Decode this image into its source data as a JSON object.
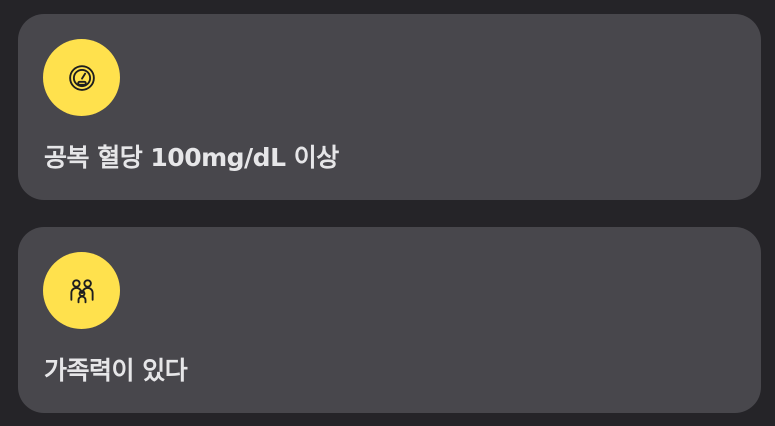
{
  "cards": [
    {
      "icon": "gauge-icon",
      "label": "공복 혈당 100mg/dL 이상"
    },
    {
      "icon": "family-icon",
      "label": "가족력이 있다"
    }
  ],
  "colors": {
    "background": "#252428",
    "card": "#48474c",
    "icon_bg": "#ffe14d",
    "text": "#e6e6e8"
  }
}
